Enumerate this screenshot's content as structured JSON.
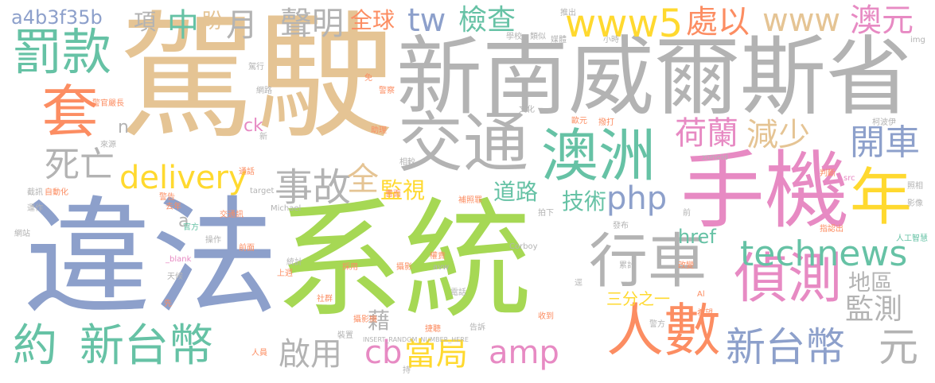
{
  "palette": {
    "tan": "#e5c494",
    "gray": "#b3b3b3",
    "green": "#66c2a5",
    "orange": "#fc8d62",
    "blue": "#8da0cb",
    "pink": "#e78ac3",
    "lime": "#a6d854",
    "yellow": "#ffd92f"
  },
  "words": [
    {
      "t": "駕駛",
      "c": "tan"
    },
    {
      "t": "違法",
      "c": "blue"
    },
    {
      "t": "系統",
      "c": "lime"
    },
    {
      "t": "新南威爾斯省",
      "c": "gray"
    },
    {
      "t": "手機",
      "c": "pink"
    },
    {
      "t": "澳洲",
      "c": "green"
    },
    {
      "t": "交通",
      "c": "gray"
    },
    {
      "t": "罰款",
      "c": "green"
    },
    {
      "t": "套",
      "c": "orange"
    },
    {
      "t": "人數",
      "c": "orange"
    },
    {
      "t": "偵測",
      "c": "pink"
    },
    {
      "t": "行車",
      "c": "gray"
    },
    {
      "t": "年",
      "c": "yellow"
    },
    {
      "t": "約",
      "c": "green"
    },
    {
      "t": "新台幣",
      "c": "green"
    },
    {
      "t": "新台幣",
      "c": "blue"
    },
    {
      "t": "元",
      "c": "gray"
    },
    {
      "t": "www5",
      "c": "yellow"
    },
    {
      "t": "www",
      "c": "tan"
    },
    {
      "t": "澳元",
      "c": "pink"
    },
    {
      "t": "technews",
      "c": "green"
    },
    {
      "t": "delivery",
      "c": "yellow"
    },
    {
      "t": "事故",
      "c": "gray"
    },
    {
      "t": "處以",
      "c": "orange"
    },
    {
      "t": "tw",
      "c": "blue"
    },
    {
      "t": "檢查",
      "c": "green"
    },
    {
      "t": "php",
      "c": "blue"
    },
    {
      "t": "amp",
      "c": "pink"
    },
    {
      "t": "cb",
      "c": "pink"
    },
    {
      "t": "當局",
      "c": "yellow"
    },
    {
      "t": "開車",
      "c": "blue"
    },
    {
      "t": "死亡",
      "c": "gray"
    },
    {
      "t": "荷蘭",
      "c": "pink"
    },
    {
      "t": "減少",
      "c": "tan"
    },
    {
      "t": "聲明",
      "c": "gray"
    },
    {
      "t": "監測",
      "c": "gray"
    },
    {
      "t": "啟用",
      "c": "gray"
    },
    {
      "t": "中",
      "c": "green"
    },
    {
      "t": "月",
      "c": "gray"
    },
    {
      "t": "全",
      "c": "tan"
    },
    {
      "t": "監視",
      "c": "yellow"
    },
    {
      "t": "道路",
      "c": "green"
    },
    {
      "t": "技術",
      "c": "green"
    },
    {
      "t": "全球",
      "c": "orange"
    },
    {
      "t": "項",
      "c": "gray"
    },
    {
      "t": "盼",
      "c": "tan"
    },
    {
      "t": "a4b3f35b",
      "c": "blue"
    },
    {
      "t": "地區",
      "c": "gray"
    },
    {
      "t": "href",
      "c": "green"
    },
    {
      "t": "藉",
      "c": "gray"
    },
    {
      "t": "三分之一",
      "c": "yellow"
    },
    {
      "t": "ck",
      "c": "pink"
    },
    {
      "t": "n",
      "c": "gray"
    },
    {
      "t": "a",
      "c": "gray"
    },
    {
      "t": "推出",
      "c": "gray"
    },
    {
      "t": "學校",
      "c": "gray"
    },
    {
      "t": "類似",
      "c": "gray"
    },
    {
      "t": "媒體",
      "c": "gray"
    },
    {
      "t": "小時",
      "c": "gray"
    },
    {
      "t": "img",
      "c": "gray"
    },
    {
      "t": "警察",
      "c": "orange"
    },
    {
      "t": "文化",
      "c": "gray"
    },
    {
      "t": "歐元",
      "c": "orange"
    },
    {
      "t": "撥打",
      "c": "orange"
    },
    {
      "t": "柯波伊",
      "c": "gray"
    },
    {
      "t": "免",
      "c": "orange"
    },
    {
      "t": "助理",
      "c": "orange"
    },
    {
      "t": "相較",
      "c": "gray"
    },
    {
      "t": "zoneid",
      "c": "gray"
    },
    {
      "t": "書面",
      "c": "orange"
    },
    {
      "t": "判斷",
      "c": "orange"
    },
    {
      "t": "src",
      "c": "pink"
    },
    {
      "t": "照相",
      "c": "gray"
    },
    {
      "t": "影像",
      "c": "gray"
    },
    {
      "t": "補照罪",
      "c": "orange"
    },
    {
      "t": "拍下",
      "c": "gray"
    },
    {
      "t": "前",
      "c": "gray"
    },
    {
      "t": "發布",
      "c": "gray"
    },
    {
      "t": "指認出",
      "c": "orange"
    },
    {
      "t": "人工智慧",
      "c": "green"
    },
    {
      "t": "Michael",
      "c": "gray"
    },
    {
      "t": "target",
      "c": "gray"
    },
    {
      "t": "交通訊",
      "c": "orange"
    },
    {
      "t": "去年",
      "c": "orange"
    },
    {
      "t": "官方",
      "c": "green"
    },
    {
      "t": "操作",
      "c": "gray"
    },
    {
      "t": "_blank",
      "c": "pink"
    },
    {
      "t": "攝影",
      "c": "orange"
    },
    {
      "t": "權責",
      "c": "orange"
    },
    {
      "t": "avw",
      "c": "gray"
    },
    {
      "t": "Corboy",
      "c": "gray"
    },
    {
      "t": "累計",
      "c": "gray"
    },
    {
      "t": "改變",
      "c": "orange"
    },
    {
      "t": "統計",
      "c": "gray"
    },
    {
      "t": "上週",
      "c": "orange"
    },
    {
      "t": "採用",
      "c": "orange"
    },
    {
      "t": "電話",
      "c": "gray"
    },
    {
      "t": "收到",
      "c": "orange"
    },
    {
      "t": "希望",
      "c": "orange"
    },
    {
      "t": "警方",
      "c": "gray"
    },
    {
      "t": "攝影機",
      "c": "orange"
    },
    {
      "t": "裝置",
      "c": "gray"
    },
    {
      "t": "INSERT_RANDOM_NUMBER_HERE",
      "c": "gray"
    },
    {
      "t": "捷聽",
      "c": "orange"
    },
    {
      "t": "告訴",
      "c": "gray"
    },
    {
      "t": "持",
      "c": "gray"
    },
    {
      "t": "人員",
      "c": "orange"
    },
    {
      "t": "社群",
      "c": "orange"
    },
    {
      "t": "警告",
      "c": "orange"
    },
    {
      "t": "天候",
      "c": "gray"
    },
    {
      "t": "先",
      "c": "orange"
    },
    {
      "t": "前面",
      "c": "orange"
    },
    {
      "t": "網站",
      "c": "gray"
    },
    {
      "t": "運作",
      "c": "gray"
    },
    {
      "t": "自動化",
      "c": "orange"
    },
    {
      "t": "截訊",
      "c": "gray"
    },
    {
      "t": "通話",
      "c": "orange"
    },
    {
      "t": "新",
      "c": "gray"
    },
    {
      "t": "來源",
      "c": "gray"
    },
    {
      "t": "警官嚴長",
      "c": "orange"
    },
    {
      "t": "網路",
      "c": "gray"
    },
    {
      "t": "駕行",
      "c": "gray"
    },
    {
      "t": "逕",
      "c": "gray"
    },
    {
      "t": "Al",
      "c": "orange"
    }
  ]
}
